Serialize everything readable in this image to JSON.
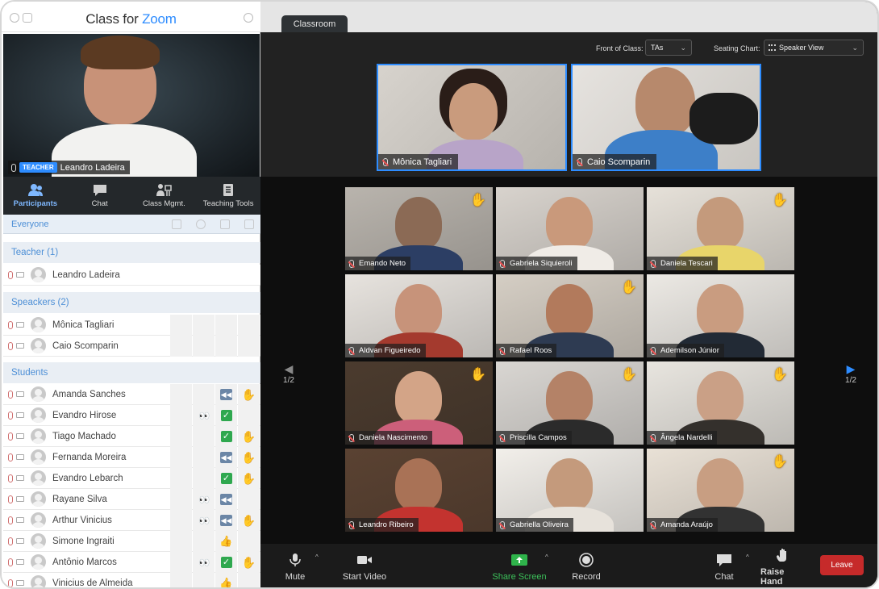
{
  "app": {
    "title_prefix": "Class for ",
    "title_brand": "Zoom"
  },
  "teacher_video": {
    "badge": "TEACHER",
    "name": "Leandro Ladeira"
  },
  "tabs": [
    {
      "label": "Participants",
      "icon": "participants-icon"
    },
    {
      "label": "Chat",
      "icon": "chat-icon"
    },
    {
      "label": "Class Mgmt.",
      "icon": "class-mgmt-icon"
    },
    {
      "label": "Teaching Tools",
      "icon": "teaching-tools-icon"
    }
  ],
  "everyone_label": "Everyone",
  "sections": {
    "teacher": "Teacher (1)",
    "speakers": "Speackers (2)",
    "students": "Students"
  },
  "teacher_rows": [
    {
      "name": "Leandro Ladeira"
    }
  ],
  "speaker_rows": [
    {
      "name": "Mônica Tagliari"
    },
    {
      "name": "Caio Scomparin"
    }
  ],
  "student_rows": [
    {
      "name": "Amanda Sanches",
      "eyes": "",
      "status": "rewind",
      "reaction": "hand"
    },
    {
      "name": "Evandro Hirose",
      "eyes": "👀",
      "status": "check",
      "reaction": ""
    },
    {
      "name": "Tiago Machado",
      "eyes": "",
      "status": "check",
      "reaction": "hand"
    },
    {
      "name": "Fernanda Moreira",
      "eyes": "",
      "status": "rewind",
      "reaction": "hand"
    },
    {
      "name": "Evandro Lebarch",
      "eyes": "",
      "status": "check",
      "reaction": "hand"
    },
    {
      "name": "Rayane Silva",
      "eyes": "👀",
      "status": "rewind",
      "reaction": ""
    },
    {
      "name": "Arthur Vinicius",
      "eyes": "👀",
      "status": "rewind",
      "reaction": "hand"
    },
    {
      "name": "Simone Ingraiti",
      "eyes": "",
      "status": "thumb",
      "reaction": ""
    },
    {
      "name": "Antônio Marcos",
      "eyes": "👀",
      "status": "check",
      "reaction": "hand"
    },
    {
      "name": "Vinicius de Almeida",
      "eyes": "",
      "status": "thumb",
      "reaction": ""
    }
  ],
  "classroom_tab": "Classroom",
  "front_of_class": {
    "label": "Front of Class:",
    "value": "TAs"
  },
  "seating_chart": {
    "label": "Seating Chart:",
    "value": "Speaker View"
  },
  "speakers_video": [
    {
      "name": "Mônica Tagliari"
    },
    {
      "name": "Caio Scomparin"
    }
  ],
  "gallery": [
    {
      "name": "Emando Neto",
      "hand": true
    },
    {
      "name": "Gabriela Siquieroli",
      "hand": false
    },
    {
      "name": "Daniela Tescari",
      "hand": true
    },
    {
      "name": "Aldvan Figueiredo",
      "hand": false
    },
    {
      "name": "Rafael Roos",
      "hand": true
    },
    {
      "name": "Ademilson Júnior",
      "hand": false
    },
    {
      "name": "Daniela Nascimento",
      "hand": true
    },
    {
      "name": "Priscilla Campos",
      "hand": true
    },
    {
      "name": "Ângela Nardelli",
      "hand": true
    },
    {
      "name": "Leandro Ribeiro",
      "hand": false
    },
    {
      "name": "Gabriella Oliveira",
      "hand": false
    },
    {
      "name": "Amanda Araújo",
      "hand": true
    }
  ],
  "pager": {
    "left": "1/2",
    "right": "1/2"
  },
  "bottom": {
    "mute": "Mute",
    "start_video": "Start Video",
    "share_screen": "Share Screen",
    "record": "Record",
    "chat": "Chat",
    "raise_hand": "Raise Hand",
    "leave": "Leave"
  },
  "colors": {
    "accent": "#2d8cff",
    "share_green": "#2fb44b",
    "leave_red": "#c62a2a",
    "hand_yellow": "#f3b91a"
  }
}
